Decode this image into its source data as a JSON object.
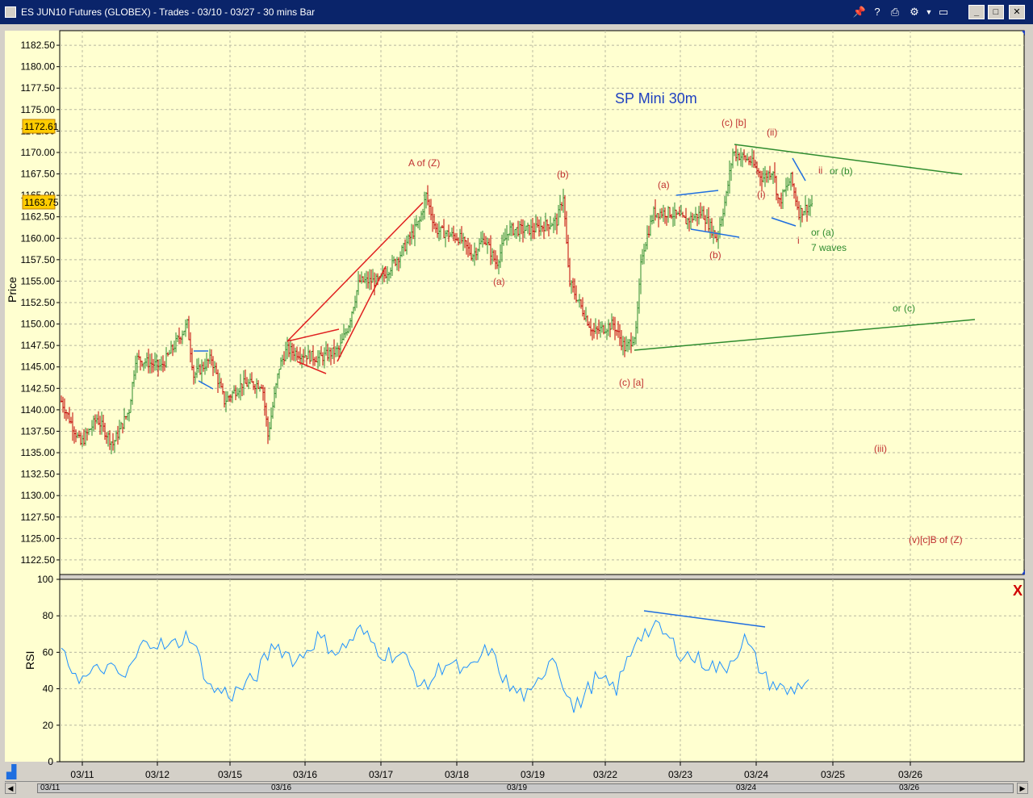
{
  "window": {
    "title": "ES JUN10 Futures (GLOBEX) - Trades - 03/10 - 03/27  - 30 mins Bar",
    "toolbar_icons": [
      "pin-icon",
      "help-icon",
      "print-icon",
      "tools-icon",
      "chevron-down-icon",
      "window-icon"
    ],
    "window_buttons": [
      "minimize",
      "maximize",
      "close"
    ]
  },
  "colors": {
    "price_bg": "#ffffd0",
    "grid": "#b8b8a0",
    "up_bar": "#2e8b2e",
    "down_bar": "#c00000",
    "rsi_line": "#1e90ff",
    "annotation_red": "#c03030",
    "annotation_green": "#2e8b2e",
    "blue_line": "#1e6ee0",
    "current_price_badge": "#ffcc00"
  },
  "price_panel": {
    "y_label": "Price",
    "title_annotation": "SP Mini 30m",
    "y_ticks": [
      "1182.50",
      "1180.00",
      "1177.50",
      "1175.00",
      "1172.50",
      "1170.00",
      "1167.50",
      "1165.00",
      "1162.50",
      "1160.00",
      "1157.50",
      "1155.00",
      "1152.50",
      "1150.00",
      "1147.50",
      "1145.00",
      "1142.50",
      "1140.00",
      "1137.50",
      "1135.00",
      "1132.50",
      "1130.00",
      "1127.50",
      "1125.00",
      "1122.50"
    ],
    "badge_high": "1172.61",
    "badge_last": "1163.75"
  },
  "rsi_panel": {
    "y_label": "RSI",
    "y_ticks": [
      "100",
      "80",
      "60",
      "40",
      "20",
      "0"
    ],
    "close_label": "X"
  },
  "x_axis": {
    "ticks": [
      "03/11",
      "03/12",
      "03/15",
      "03/16",
      "03/17",
      "03/18",
      "03/19",
      "03/22",
      "03/23",
      "03/24",
      "03/25",
      "03/26"
    ],
    "scroll_labels": [
      "03/11",
      "03/16",
      "03/19",
      "03/24",
      "03/26"
    ]
  },
  "annotations": [
    {
      "text": "A of (Z)",
      "color": "red"
    },
    {
      "text": "(b)",
      "color": "red"
    },
    {
      "text": "(a)",
      "color": "red"
    },
    {
      "text": "(c) [a]",
      "color": "red"
    },
    {
      "text": "(a)",
      "color": "red"
    },
    {
      "text": "(b)",
      "color": "red"
    },
    {
      "text": "(c) [b]",
      "color": "red"
    },
    {
      "text": "(ii)",
      "color": "red"
    },
    {
      "text": "(i)",
      "color": "red"
    },
    {
      "text": "ii",
      "color": "red"
    },
    {
      "text": "or (b)",
      "color": "green"
    },
    {
      "text": "i",
      "color": "red"
    },
    {
      "text": "or (a)",
      "color": "green"
    },
    {
      "text": "7 waves",
      "color": "green"
    },
    {
      "text": "or (c)",
      "color": "green"
    },
    {
      "text": "(iii)",
      "color": "red"
    },
    {
      "text": "(v)[c]B of (Z)",
      "color": "red"
    }
  ],
  "chart_data": [
    {
      "type": "candlestick",
      "title": "SP Mini 30m",
      "ylabel": "Price",
      "ylim": [
        1120.8,
        1184.2
      ],
      "categories": [
        "03/11",
        "03/12",
        "03/15",
        "03/16",
        "03/17",
        "03/18",
        "03/19",
        "03/22",
        "03/23",
        "03/24",
        "03/25",
        "03/26"
      ],
      "series": [
        {
          "name": "",
          "x": [
            "03/10",
            "03/11",
            "03/11",
            "03/12",
            "03/12",
            "03/15",
            "03/15",
            "03/16",
            "03/16",
            "03/17",
            "03/17",
            "03/18",
            "03/18",
            "03/19",
            "03/19",
            "03/22",
            "03/22",
            "03/23",
            "03/23",
            "03/24",
            "03/24"
          ],
          "values": [
            1141,
            1136,
            1140,
            1146,
            1150,
            1141,
            1145,
            1147,
            1146,
            1156,
            1164,
            1161,
            1159,
            1162,
            1163,
            1150,
            1148,
            1163,
            1162,
            1170,
            1163
          ]
        }
      ],
      "current_price": 1163.75,
      "high_marker": 1172.61
    },
    {
      "type": "line",
      "ylabel": "RSI",
      "ylim": [
        0,
        100
      ],
      "series": [
        {
          "name": "",
          "values": [
            58,
            45,
            52,
            46,
            68,
            62,
            70,
            40,
            37,
            45,
            65,
            55,
            68,
            60,
            72,
            60,
            58,
            40,
            55,
            48,
            62,
            40,
            35,
            60,
            28,
            45,
            40,
            70,
            73,
            60,
            55,
            50,
            67,
            45,
            38,
            45
          ]
        }
      ]
    }
  ]
}
